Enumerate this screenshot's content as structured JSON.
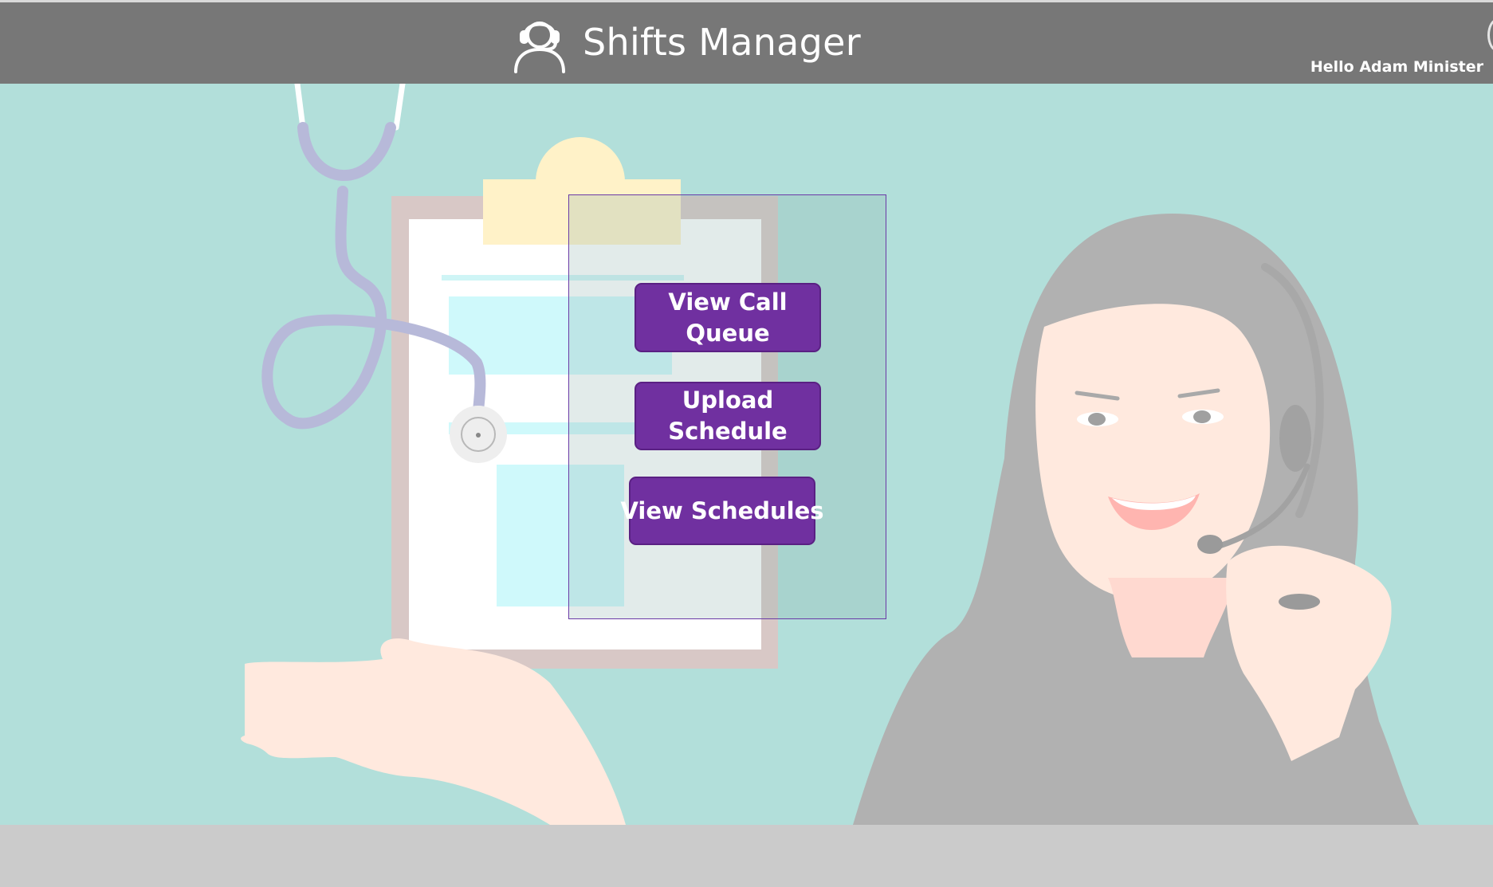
{
  "header": {
    "title": "Shifts Manager",
    "greeting": "Hello Adam Minister",
    "logo_icon": "headset-user-icon",
    "background_color": "#777777"
  },
  "main": {
    "background_color": "#b2dfda",
    "actions": [
      {
        "label": "View Call Queue",
        "icon": "none"
      },
      {
        "label": "Upload Schedule",
        "icon": "none"
      },
      {
        "label": "View Schedules",
        "icon": "none"
      }
    ],
    "accent_color": "#7030a0"
  },
  "footer": {
    "background_color": "#cbcbcb"
  }
}
